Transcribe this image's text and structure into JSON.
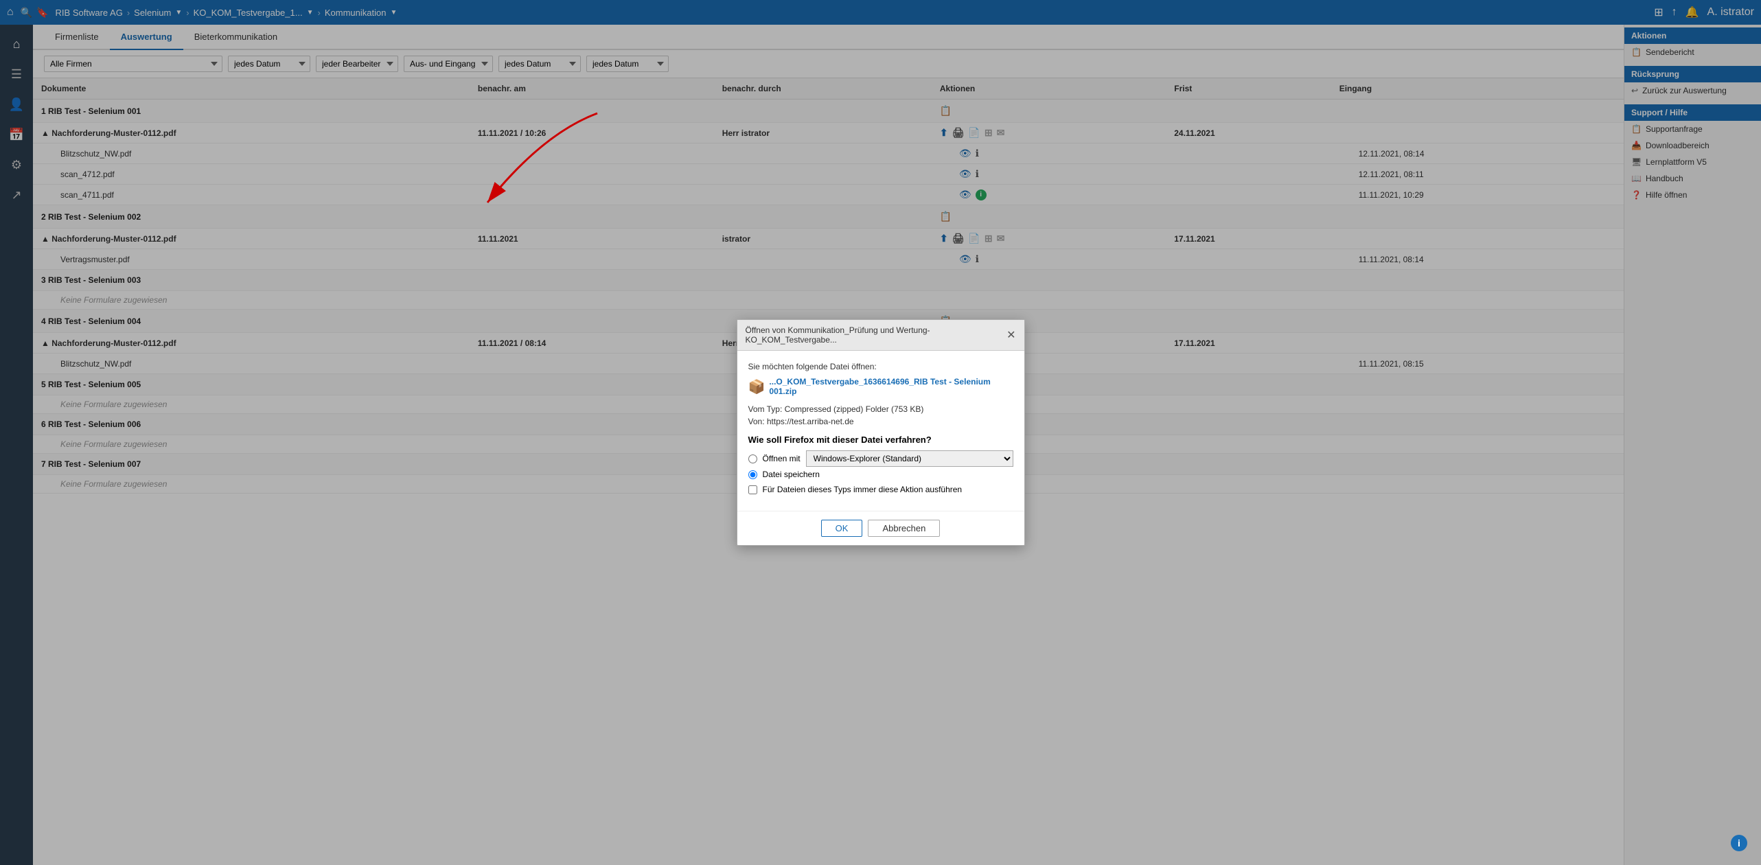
{
  "topNav": {
    "homeIcon": "⌂",
    "searchIcon": "🔍",
    "bookmarkIcon": "🔖",
    "breadcrumb": [
      {
        "label": "RIB Software AG",
        "hasDropdown": false
      },
      {
        "label": "Selenium",
        "hasDropdown": true
      },
      {
        "label": "KO_KOM_Testvergabe_1...",
        "hasDropdown": true
      },
      {
        "label": "Kommunikation",
        "hasDropdown": true
      }
    ],
    "rightIcons": [
      "⊞",
      "↑",
      "🔔",
      "👤"
    ],
    "userName": "A. istrator"
  },
  "sidebar": {
    "icons": [
      {
        "name": "home-icon",
        "symbol": "⌂"
      },
      {
        "name": "menu-icon",
        "symbol": "☰"
      },
      {
        "name": "person-icon",
        "symbol": "👤"
      },
      {
        "name": "calendar-icon",
        "symbol": "📅"
      },
      {
        "name": "settings-icon",
        "symbol": "⚙"
      },
      {
        "name": "export-icon",
        "symbol": "↗"
      }
    ]
  },
  "tabs": [
    {
      "label": "Firmenliste",
      "active": false
    },
    {
      "label": "Auswertung",
      "active": true
    },
    {
      "label": "Bieterkommunikation",
      "active": false
    }
  ],
  "filters": [
    {
      "label": "Alle Firmen",
      "wide": true
    },
    {
      "label": "jedes Datum",
      "wide": false
    },
    {
      "label": "jeder Bearbeiter",
      "wide": false
    },
    {
      "label": "Aus- und Eingang",
      "wide": false
    },
    {
      "label": "jedes Datum",
      "wide": false
    },
    {
      "label": "jedes Datum",
      "wide": false
    }
  ],
  "tableHeaders": [
    {
      "label": "Dokumente"
    },
    {
      "label": "benachr. am"
    },
    {
      "label": "benachr. durch"
    },
    {
      "label": "Aktionen"
    },
    {
      "label": "Frist"
    },
    {
      "label": "Eingang"
    }
  ],
  "tableRows": [
    {
      "type": "section",
      "label": "1 RIB Test - Selenium 001"
    },
    {
      "type": "subsection",
      "label": "Nachforderung-Muster-0112.pdf",
      "date": "11.11.2021 / 10:26",
      "by": "Herr istrator",
      "actions": [
        "upload",
        "print",
        "frist",
        "mail"
      ],
      "frist": "24.11.2021",
      "eingang": ""
    },
    {
      "type": "file",
      "label": "Blitzschutz_NW.pdf",
      "actions": [
        "eye",
        "info"
      ],
      "eingang": "12.11.2021, 08:14"
    },
    {
      "type": "file",
      "label": "scan_4712.pdf",
      "actions": [
        "eye",
        "info"
      ],
      "eingang": "12.11.2021, 08:11"
    },
    {
      "type": "file",
      "label": "scan_4711.pdf",
      "actions": [
        "eye",
        "info-green"
      ],
      "eingang": "11.11.2021, 10:29"
    },
    {
      "type": "section",
      "label": "2 RIB Test - Selenium 002"
    },
    {
      "type": "subsection",
      "label": "Nachforderung-Muster-0112.pdf",
      "date": "11.11.2021",
      "by": "istrator",
      "actions": [
        "upload",
        "print",
        "frist",
        "mail"
      ],
      "frist": "17.11.2021",
      "eingang": ""
    },
    {
      "type": "file",
      "label": "Vertragsmuster.pdf",
      "actions": [
        "eye",
        "info"
      ],
      "eingang": "11.11.2021, 08:14"
    },
    {
      "type": "section",
      "label": "3 RIB Test - Selenium 003"
    },
    {
      "type": "empty",
      "label": "Keine Formulare zugewiesen"
    },
    {
      "type": "section",
      "label": "4 RIB Test - Selenium 004"
    },
    {
      "type": "subsection",
      "label": "Nachforderung-Muster-0112.pdf",
      "date": "11.11.2021 / 08:14",
      "by": "Herr istrator",
      "actions": [
        "upload",
        "print",
        "frist",
        "mail"
      ],
      "frist": "17.11.2021",
      "eingang": ""
    },
    {
      "type": "file",
      "label": "Blitzschutz_NW.pdf",
      "actions": [
        "eye",
        "info"
      ],
      "eingang": "11.11.2021, 08:15"
    },
    {
      "type": "section",
      "label": "5 RIB Test - Selenium 005"
    },
    {
      "type": "empty",
      "label": "Keine Formulare zugewiesen"
    },
    {
      "type": "section",
      "label": "6 RIB Test - Selenium 006"
    },
    {
      "type": "empty",
      "label": "Keine Formulare zugewiesen"
    },
    {
      "type": "section",
      "label": "7 RIB Test - Selenium 007"
    },
    {
      "type": "empty",
      "label": "Keine Formulare zugewiesen"
    }
  ],
  "rightSidebar": {
    "sections": [
      {
        "header": "Aktionen",
        "links": [
          {
            "icon": "📋",
            "label": "Sendebericht"
          }
        ]
      },
      {
        "header": "Rücksprung",
        "links": [
          {
            "icon": "↩",
            "label": "Zurück zur Auswertung"
          }
        ]
      },
      {
        "header": "Support / Hilfe",
        "links": [
          {
            "icon": "📋",
            "label": "Supportanfrage"
          },
          {
            "icon": "📥",
            "label": "Downloadbereich"
          },
          {
            "icon": "🖥",
            "label": "Lernplattform V5"
          },
          {
            "icon": "📖",
            "label": "Handbuch"
          },
          {
            "icon": "❓",
            "label": "Hilfe öffnen"
          }
        ]
      }
    ]
  },
  "modal": {
    "title": "Öffnen von Kommunikation_Prüfung und Wertung-KO_KOM_Testvergabe...",
    "promptText": "Sie möchten folgende Datei öffnen:",
    "fileName": "...O_KOM_Testvergabe_1636614696_RIB Test - Selenium 001.zip",
    "fileType": "Vom Typ: Compressed (zipped) Folder (753 KB)",
    "fileFrom": "Von:  https://test.arriba-net.de",
    "question": "Wie soll Firefox mit dieser Datei verfahren?",
    "openWithLabel": "Öffnen mit",
    "openWithOption": "Windows-Explorer (Standard)",
    "saveLabel": "Datei speichern",
    "checkboxLabel": "Für Dateien dieses Typs immer diese Aktion ausführen",
    "okLabel": "OK",
    "cancelLabel": "Abbrechen"
  }
}
